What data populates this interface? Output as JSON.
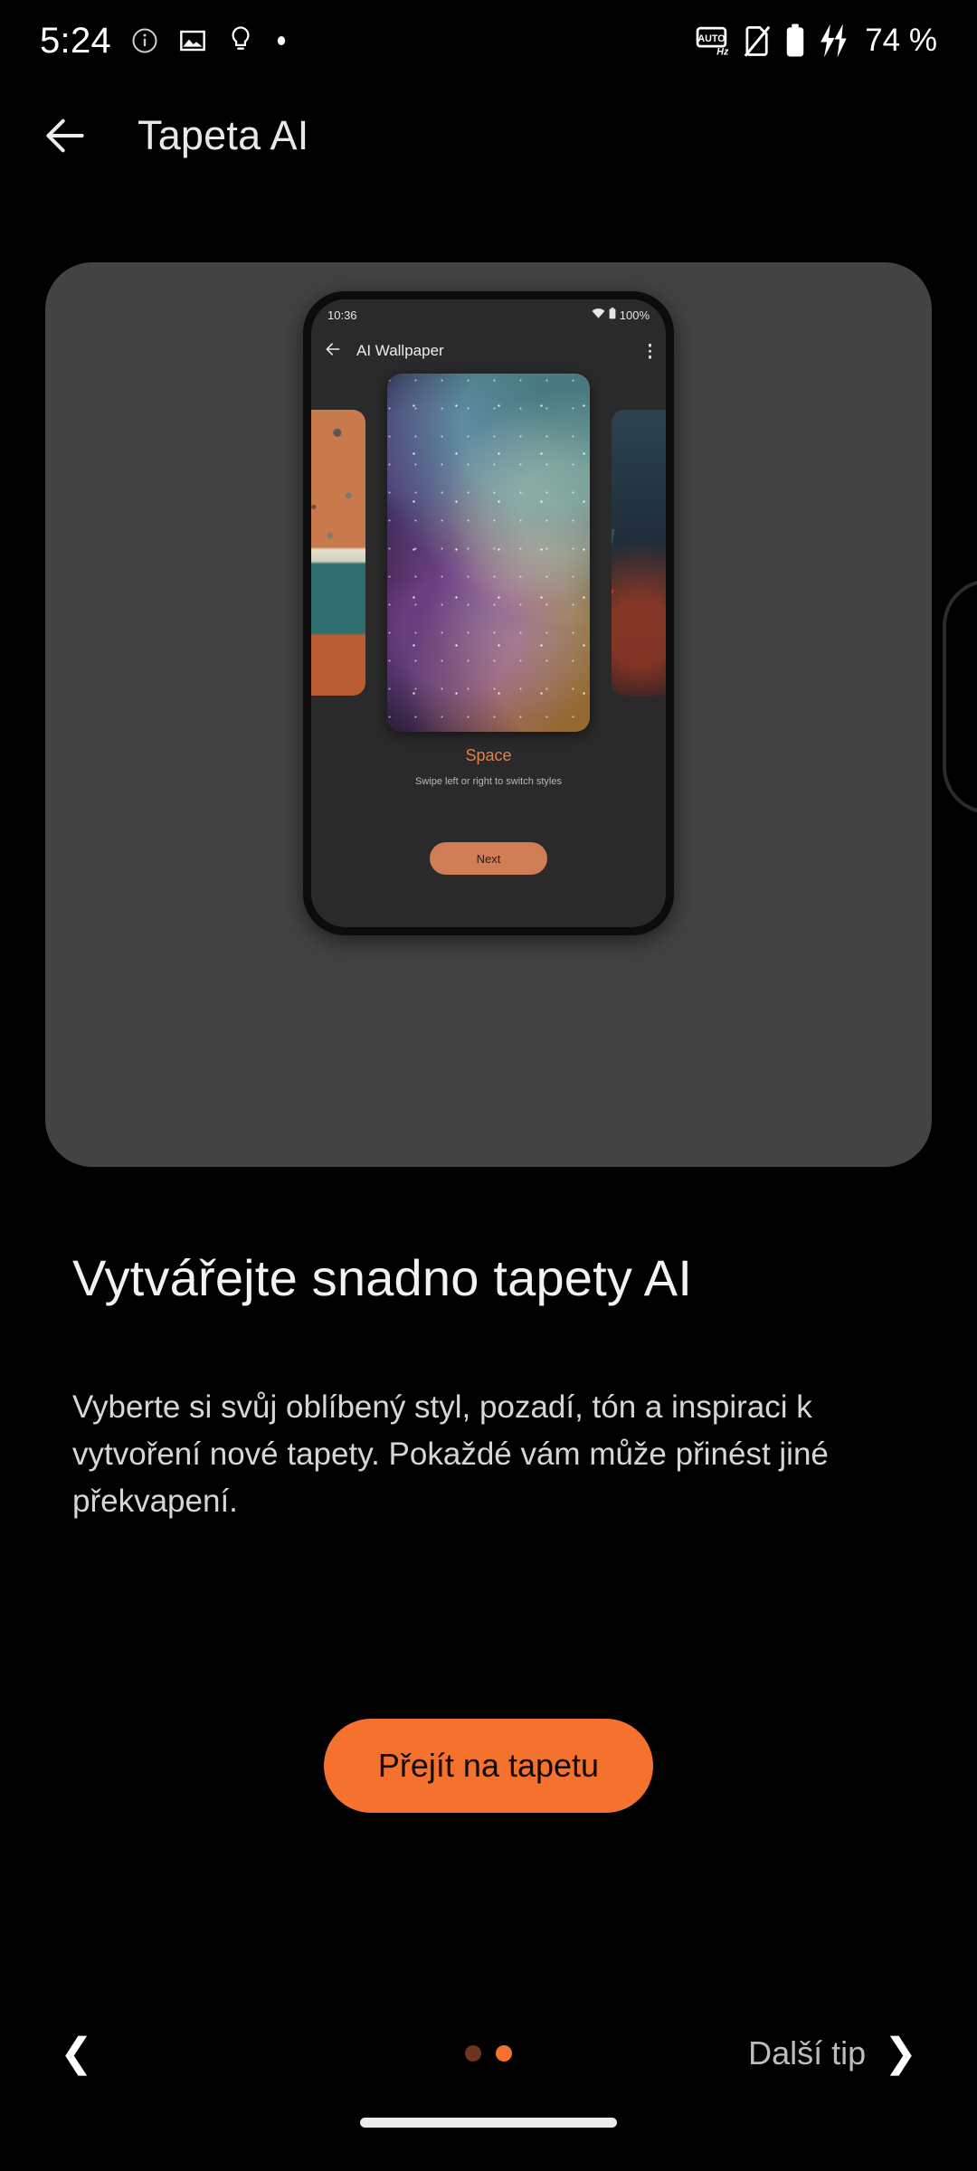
{
  "status_bar": {
    "time": "5:24",
    "battery_percent": "74 %",
    "left_icons": [
      "info-circle-icon",
      "image-icon",
      "lightbulb-icon",
      "dot-icon"
    ],
    "right_icons": [
      "auto-hz-icon",
      "no-sim-icon",
      "battery-icon",
      "charging-bolt-icon"
    ]
  },
  "app_bar": {
    "back_icon": "arrow-left-icon",
    "title": "Tapeta AI"
  },
  "hero": {
    "phone_mock": {
      "status_time": "10:36",
      "battery_percent": "100%",
      "wifi_icon": "wifi-icon",
      "battery_icon": "battery-icon",
      "back_icon": "arrow-left-icon",
      "title": "AI Wallpaper",
      "overflow_icon": "more-vert-icon",
      "carousel": {
        "prev_icon": "chevron-left-icon",
        "next_icon": "chevron-right-icon",
        "items": [
          {
            "name": "abstract-terracotta-wallpaper",
            "position": "left-peek"
          },
          {
            "name": "space-nebula-wallpaper",
            "position": "center-active"
          },
          {
            "name": "cyberpunk-wallpaper",
            "position": "right-peek"
          }
        ]
      },
      "style_name": "Space",
      "style_hint": "Swipe left or right to switch styles",
      "next_button": "Next"
    }
  },
  "content": {
    "headline": "Vytvářejte snadno tapety AI",
    "body": "Vyberte si svůj oblíbený styl, pozadí, tón a inspiraci k vytvoření nové tapety. Pokaždé vám může přinést jiné překvapení."
  },
  "cta": {
    "label": "Přejít na tapetu"
  },
  "bottom_bar": {
    "prev_icon": "chevron-left-icon",
    "next_label": "Další tip",
    "next_icon": "chevron-right-icon",
    "pagination": {
      "total": 2,
      "active_index": 1
    }
  },
  "colors": {
    "accent": "#f4712e",
    "accent_muted": "#cf7e55",
    "dot_inactive": "#6b3520",
    "background": "#000000",
    "card": "#434343",
    "style_name": "#e08050"
  }
}
